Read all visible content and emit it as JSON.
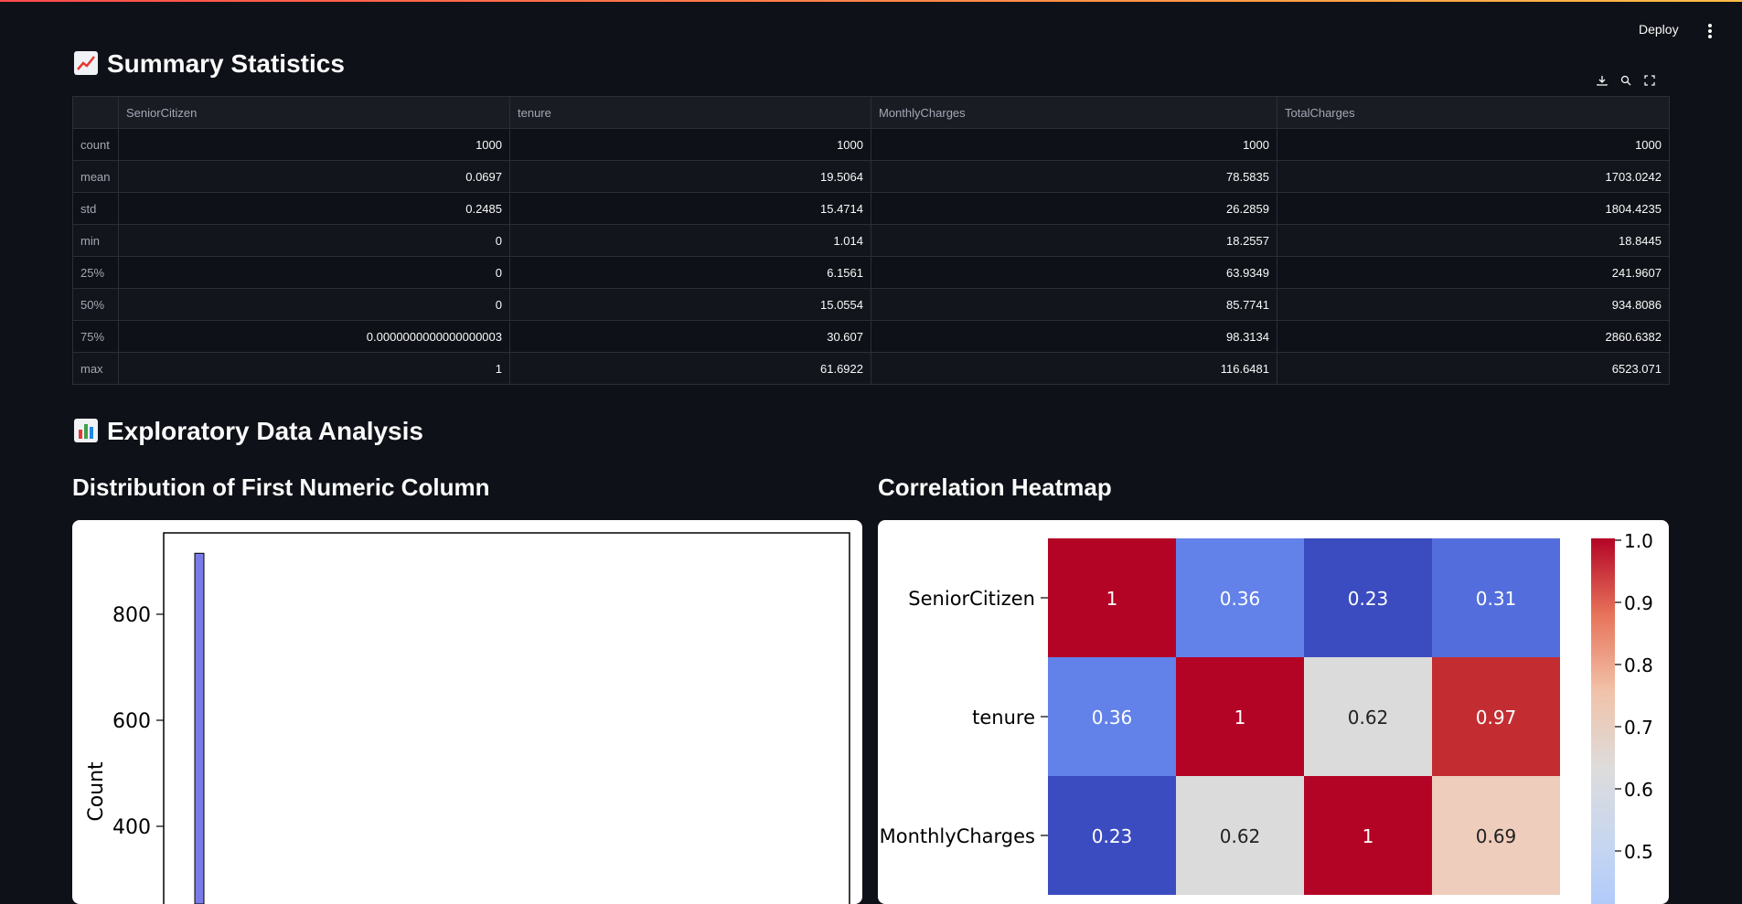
{
  "header": {
    "deploy_label": "Deploy",
    "menu_icon": "more-vertical-icon"
  },
  "summary": {
    "title": "Summary Statistics",
    "emoji_icon": "chart-increasing-icon",
    "toolbar": {
      "download_icon": "download-icon",
      "search_icon": "search-icon",
      "fullscreen_icon": "fullscreen-icon"
    },
    "columns": [
      "",
      "SeniorCitizen",
      "tenure",
      "MonthlyCharges",
      "TotalCharges"
    ],
    "rows": [
      [
        "count",
        "1000",
        "1000",
        "1000",
        "1000"
      ],
      [
        "mean",
        "0.0697",
        "19.5064",
        "78.5835",
        "1703.0242"
      ],
      [
        "std",
        "0.2485",
        "15.4714",
        "26.2859",
        "1804.4235"
      ],
      [
        "min",
        "0",
        "1.014",
        "18.2557",
        "18.8445"
      ],
      [
        "25%",
        "0",
        "6.1561",
        "63.9349",
        "241.9607"
      ],
      [
        "50%",
        "0",
        "15.0554",
        "85.7741",
        "934.8086"
      ],
      [
        "75%",
        "0.0000000000000000003",
        "30.607",
        "98.3134",
        "2860.6382"
      ],
      [
        "max",
        "1",
        "61.6922",
        "116.6481",
        "6523.071"
      ]
    ]
  },
  "eda": {
    "title": "Exploratory Data Analysis",
    "emoji_icon": "bar-chart-icon"
  },
  "chart_data": [
    {
      "type": "bar",
      "title": "Distribution of First Numeric Column",
      "xlabel": "",
      "ylabel": "Count",
      "yticks": [
        400,
        600,
        800
      ],
      "bar_color": "#7b7be8",
      "values": [
        915
      ]
    },
    {
      "type": "heatmap",
      "title": "Correlation Heatmap",
      "rows": [
        "SeniorCitizen",
        "tenure",
        "MonthlyCharges"
      ],
      "values": [
        [
          1,
          0.36,
          0.23,
          0.31
        ],
        [
          0.36,
          1,
          0.62,
          0.97
        ],
        [
          0.23,
          0.62,
          1,
          0.69
        ]
      ],
      "cell_labels": [
        [
          "1",
          "0.36",
          "0.23",
          "0.31"
        ],
        [
          "0.36",
          "1",
          "0.62",
          "0.97"
        ],
        [
          "0.23",
          "0.62",
          "1",
          "0.69"
        ]
      ],
      "colorbar_ticks": [
        "1.0",
        "0.9",
        "0.8",
        "0.7",
        "0.6",
        "0.5"
      ],
      "colormap": "coolwarm",
      "vmin": 0.23,
      "vmax": 1.0
    }
  ]
}
